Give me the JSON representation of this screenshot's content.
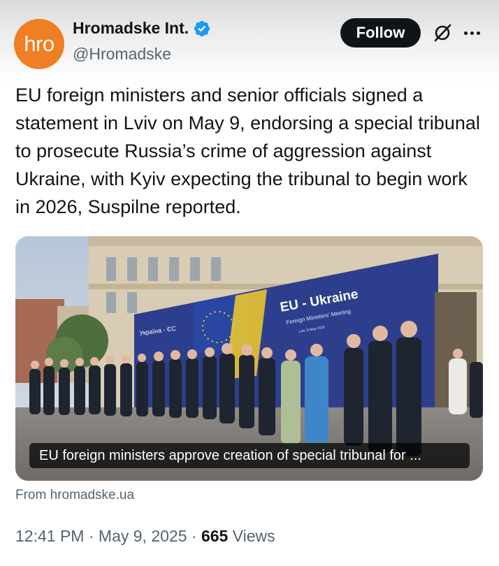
{
  "author": {
    "avatar_text": "hro",
    "display_name": "Hromadske Int.",
    "handle": "@Hromadske",
    "verified": true,
    "avatar_color": "#f07e22",
    "badge_color": "#1d9bf0"
  },
  "actions": {
    "follow_label": "Follow",
    "grok_icon": "grok-icon",
    "more_icon": "more-icon"
  },
  "tweet": {
    "text": "EU foreign ministers and senior officials signed a statement in Lviv on May 9, endorsing a special tribunal to prosecute Russia’s crime of aggression against Ukraine, with Kyiv expecting the tribunal to begin work in 2026, Suspilne reported."
  },
  "media": {
    "banner_title": "EU - Ukraine",
    "banner_subtitle": "Foreign Ministers' Meeting",
    "banner_date": "Lviv, 9 May 2025",
    "banner_left": "Україна - ЄС",
    "caption": "EU foreign ministers approve creation of special tribunal for ..."
  },
  "source": "From hromadske.ua",
  "meta": {
    "time": "12:41 PM",
    "date": "May 9, 2025",
    "views_count": "665",
    "views_label": "Views",
    "separator": "·"
  }
}
